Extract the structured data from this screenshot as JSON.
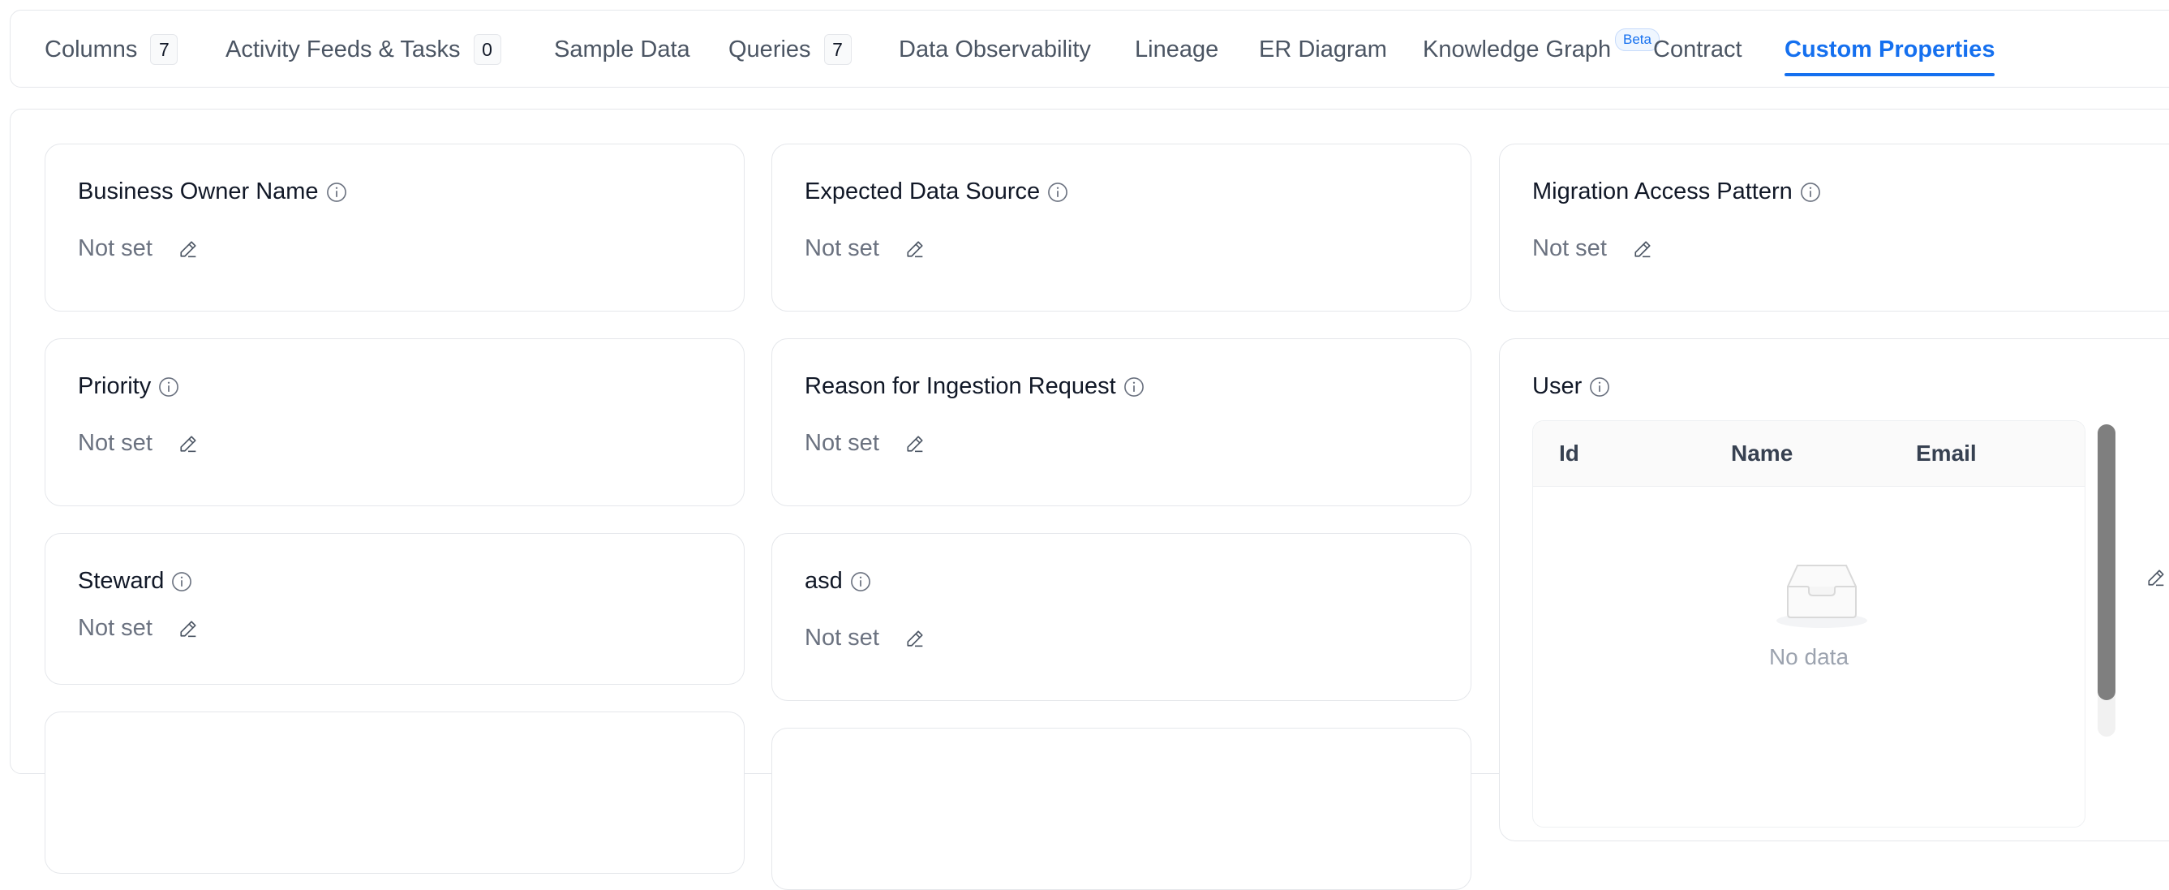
{
  "tabs": [
    {
      "label": "Columns",
      "count": "7"
    },
    {
      "label": "Activity Feeds & Tasks",
      "count": "0"
    },
    {
      "label": "Sample Data"
    },
    {
      "label": "Queries",
      "count": "7"
    },
    {
      "label": "Data Observability"
    },
    {
      "label": "Lineage"
    },
    {
      "label": "ER Diagram"
    },
    {
      "label": "Knowledge Graph",
      "badge": "Beta"
    },
    {
      "label": "Contract"
    },
    {
      "label": "Custom Properties",
      "active": true
    }
  ],
  "properties": [
    {
      "name": "Business Owner Name",
      "value": "Not set"
    },
    {
      "name": "Expected Data Source",
      "value": "Not set"
    },
    {
      "name": "Migration Access Pattern",
      "value": "Not set"
    },
    {
      "name": "Priority",
      "value": "Not set"
    },
    {
      "name": "Reason for Ingestion Request",
      "value": "Not set"
    },
    {
      "name": "Steward",
      "value": "Not set"
    },
    {
      "name": "asd",
      "value": "Not set"
    }
  ],
  "user_property": {
    "name": "User",
    "columns": [
      "Id",
      "Name",
      "Email"
    ],
    "empty_text": "No data"
  },
  "colors": {
    "accent": "#1570ef",
    "border": "#e5e7eb",
    "muted_text": "#6b7280"
  },
  "icons": {
    "info": "info-circle-icon",
    "edit": "pencil-icon",
    "empty": "inbox-icon"
  }
}
